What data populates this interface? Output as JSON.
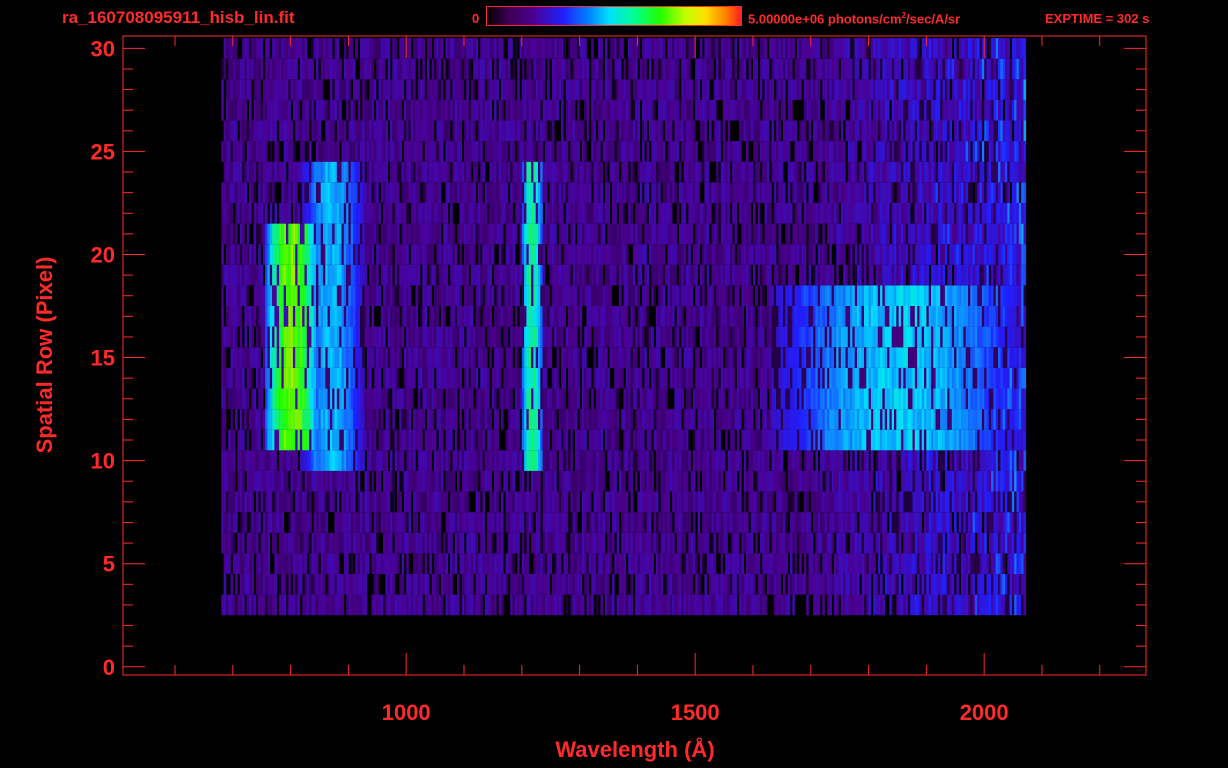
{
  "header": {
    "filename": "ra_160708095911_hisb_lin.fit",
    "colorbar_min": "0",
    "colorbar_max_prefix": "5.00000e+06 photons/cm",
    "colorbar_max_sup": "2",
    "colorbar_max_suffix": "/sec/A/sr",
    "exptime": "EXPTIME = 302 s"
  },
  "colors": {
    "axis": "#ff2a2a",
    "background": "#000000",
    "colormap": [
      "#000000",
      "#4b0090",
      "#2020ff",
      "#00e0ff",
      "#20ff00",
      "#ffe000",
      "#ff2020"
    ]
  },
  "chart_data": {
    "type": "heatmap",
    "title": "ra_160708095911_hisb_lin.fit",
    "xlabel": "Wavelength (Å)",
    "ylabel": "Spatial Row (Pixel)",
    "xlim": [
      510,
      2280
    ],
    "ylim": [
      -0.4,
      30.6
    ],
    "x_ticks": [
      1000,
      1500,
      2000
    ],
    "x_minor_ticks": [
      600,
      700,
      800,
      900,
      1100,
      1200,
      1300,
      1400,
      1600,
      1700,
      1800,
      1900,
      2100,
      2200
    ],
    "y_ticks": [
      0,
      5,
      10,
      15,
      20,
      25,
      30
    ],
    "y_minor_ticks": [
      1,
      2,
      3,
      4,
      6,
      7,
      8,
      9,
      11,
      12,
      13,
      14,
      16,
      17,
      18,
      19,
      21,
      22,
      23,
      24,
      26,
      27,
      28,
      29
    ],
    "colorbar_range": [
      0,
      5000000
    ],
    "colorbar_units": "photons/cm2/sec/A/sr",
    "data_extent": {
      "x": [
        680,
        2070
      ],
      "y": [
        3,
        30
      ]
    },
    "features": [
      {
        "x_center": 800,
        "x_width": 45,
        "y_range": [
          11,
          21
        ],
        "intensity": 0.78
      },
      {
        "x_center": 870,
        "x_width": 55,
        "y_range": [
          10,
          24
        ],
        "intensity": 0.5
      },
      {
        "x_center": 1216,
        "x_width": 20,
        "y_range": [
          10,
          24
        ],
        "intensity": 0.62
      },
      {
        "x_center": 1850,
        "x_width": 220,
        "y_range": [
          11,
          18
        ],
        "intensity": 0.52
      }
    ]
  }
}
